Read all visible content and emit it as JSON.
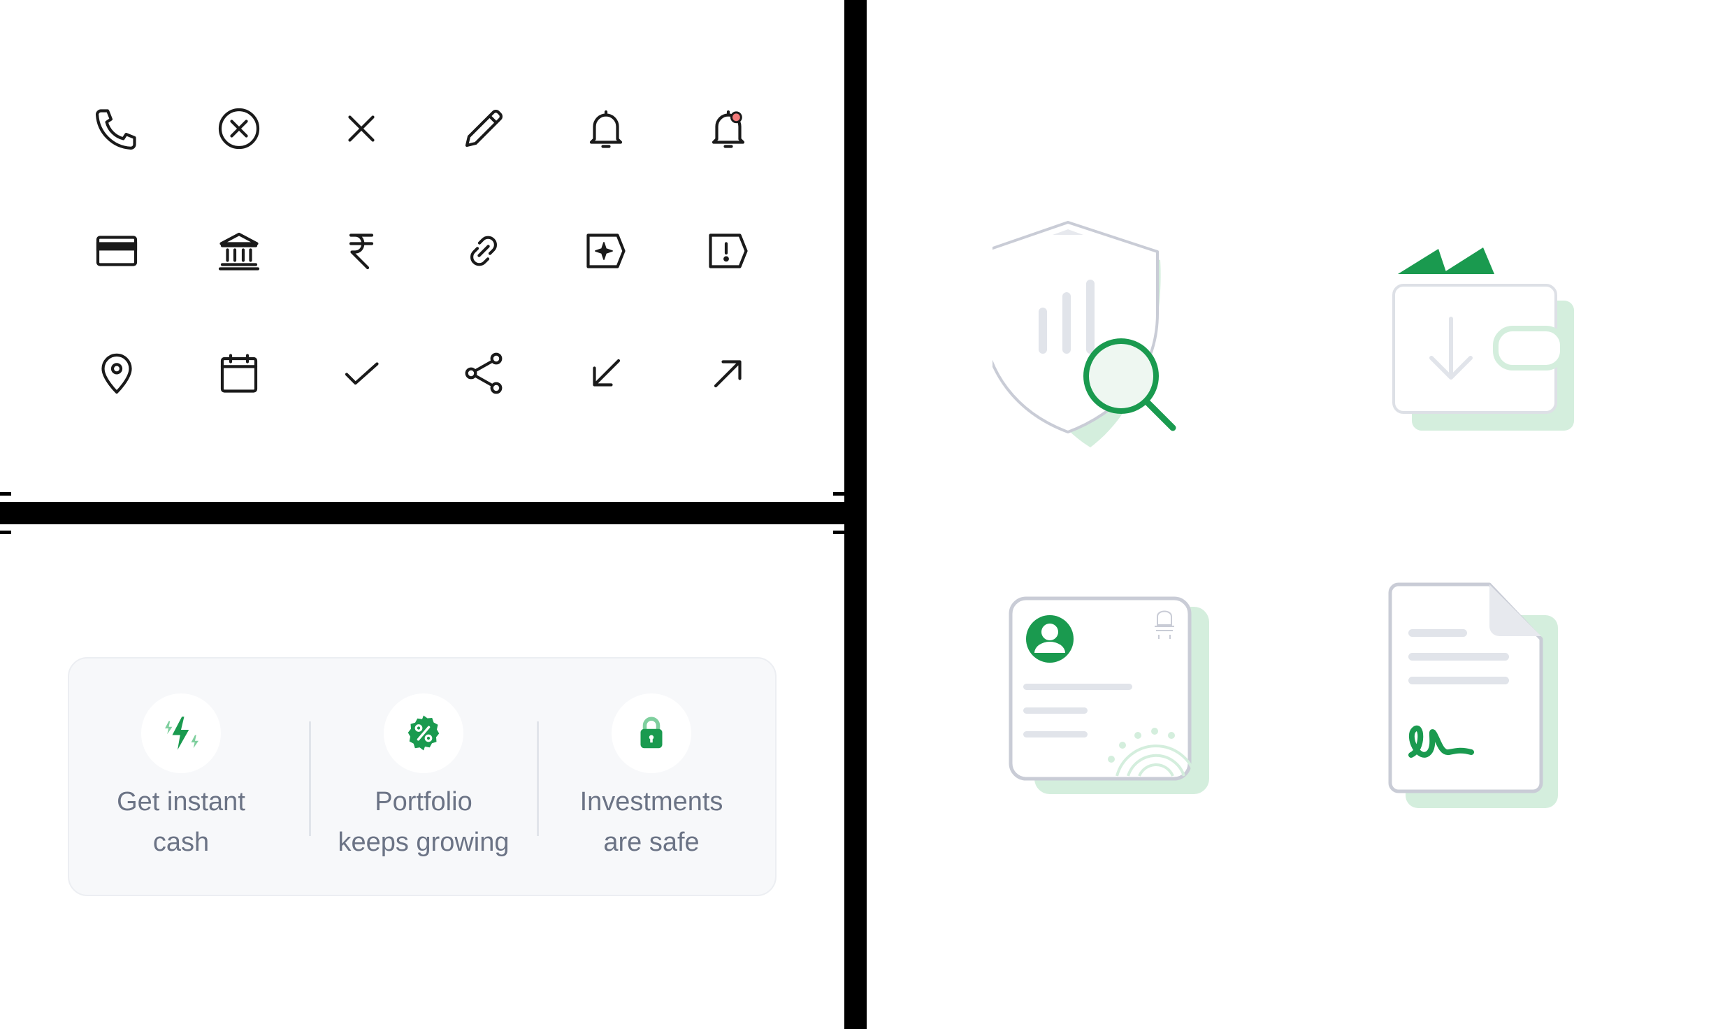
{
  "icon_grid": {
    "rows": [
      [
        "phone-icon",
        "close-circle-icon",
        "close-icon",
        "pencil-icon",
        "bell-icon",
        "bell-notification-icon"
      ],
      [
        "credit-card-icon",
        "bank-icon",
        "rupee-icon",
        "link-icon",
        "sparkle-tag-icon",
        "alert-tag-icon"
      ],
      [
        "location-pin-icon",
        "calendar-icon",
        "check-icon",
        "share-icon",
        "arrow-down-left-icon",
        "arrow-up-right-icon"
      ]
    ],
    "stroke_color": "#1a1a1a",
    "notification_dot_color": "#f27a7a"
  },
  "features": [
    {
      "icon": "lightning-icon",
      "line1": "Get instant",
      "line2": "cash"
    },
    {
      "icon": "percent-badge-icon",
      "line1": "Portfolio",
      "line2": "keeps growing"
    },
    {
      "icon": "lock-icon",
      "line1": "Investments",
      "line2": "are safe"
    }
  ],
  "illustrations": [
    "shield-search-illustration",
    "wallet-download-illustration",
    "id-card-illustration",
    "signed-document-illustration"
  ],
  "colors": {
    "accent_green": "#1a9a4f",
    "light_green": "#d4eedd",
    "outline_gray": "#c9ccd6",
    "text_gray": "#6b7385",
    "card_bg": "#f7f8fa"
  }
}
